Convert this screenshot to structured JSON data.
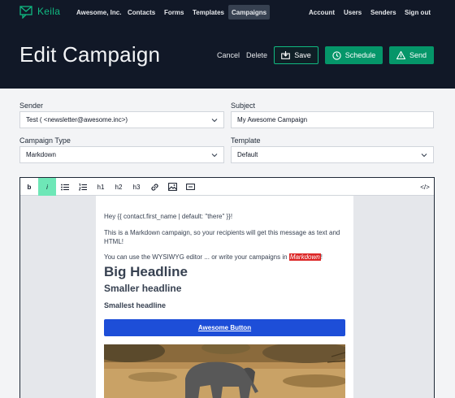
{
  "nav": {
    "brand": "Keila",
    "items": [
      "Awesome, Inc.",
      "Contacts",
      "Forms",
      "Templates",
      "Campaigns"
    ],
    "active": "Campaigns",
    "right": [
      "Account",
      "Users",
      "Senders",
      "Sign out"
    ]
  },
  "header": {
    "title": "Edit Campaign",
    "cancel": "Cancel",
    "delete": "Delete",
    "save": "Save",
    "schedule": "Schedule",
    "send": "Send"
  },
  "form": {
    "sender_label": "Sender",
    "sender_value": "Test ( <newsletter@awesome.inc>)",
    "subject_label": "Subject",
    "subject_value": "My Awesome Campaign",
    "type_label": "Campaign Type",
    "type_value": "Markdown",
    "template_label": "Template",
    "template_value": "Default"
  },
  "toolbar": {
    "bold": "b",
    "italic": "i",
    "h1": "h1",
    "h2": "h2",
    "h3": "h3",
    "code": "</>"
  },
  "content": {
    "greeting": "Hey {{ contact.first_name | default: \"there\" }}!",
    "intro": "This is a Markdown campaign, so your recipients will get this message as text and HTML!",
    "wysiwyg_before": "You can use the WYSIWYG editor ... or write your campaigns in ",
    "wysiwyg_mark": "Markdown",
    "wysiwyg_after": "!",
    "big_headline": "Big Headline",
    "smaller_headline": "Smaller headline",
    "smallest_headline": "Smallest headline",
    "button": "Awesome Button"
  },
  "colors": {
    "background": "#111827",
    "accent": "#10b981",
    "accent_dark": "#059669",
    "button_blue": "#1d4ed8",
    "highlight": "#dc2626",
    "italic_active": "#6ee7b7"
  }
}
